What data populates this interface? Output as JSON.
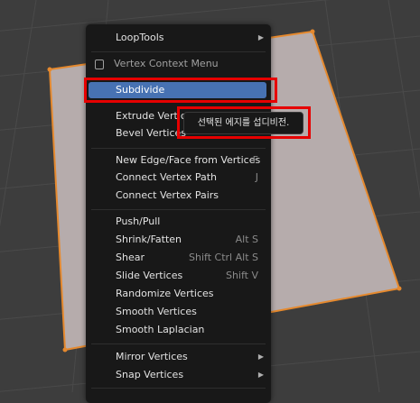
{
  "menu": {
    "top_item": "LoopTools",
    "title": "Vertex Context Menu",
    "items": [
      {
        "label": "Subdivide",
        "shortcut": ""
      },
      {
        "label": "Extrude Vertices",
        "shortcut": ""
      },
      {
        "label": "Bevel Vertices",
        "shortcut": ""
      },
      {
        "label": "New Edge/Face from Vertices",
        "shortcut": "F"
      },
      {
        "label": "Connect Vertex Path",
        "shortcut": "J"
      },
      {
        "label": "Connect Vertex Pairs",
        "shortcut": ""
      },
      {
        "label": "Push/Pull",
        "shortcut": ""
      },
      {
        "label": "Shrink/Fatten",
        "shortcut": "Alt S"
      },
      {
        "label": "Shear",
        "shortcut": "Shift Ctrl Alt S"
      },
      {
        "label": "Slide Vertices",
        "shortcut": "Shift V"
      },
      {
        "label": "Randomize Vertices",
        "shortcut": ""
      },
      {
        "label": "Smooth Vertices",
        "shortcut": ""
      },
      {
        "label": "Smooth Laplacian",
        "shortcut": ""
      },
      {
        "label": "Mirror Vertices",
        "shortcut": ""
      },
      {
        "label": "Snap Vertices",
        "shortcut": ""
      }
    ]
  },
  "tooltip": {
    "text": "선택된 에지를 섭디비전."
  },
  "colors": {
    "highlight": "#4772b3",
    "callout": "#e60000",
    "mesh_face": "#b6acac",
    "selected_edge": "#e5892e",
    "menu_bg": "#181818"
  },
  "icons": {
    "submenu": "triangle-right-icon",
    "title": "vertex-menu-icon"
  }
}
